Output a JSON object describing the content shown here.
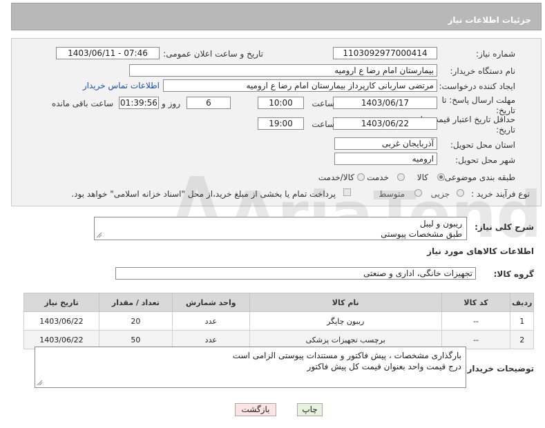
{
  "header": {
    "title": "جزئیات اطلاعات نیاز"
  },
  "form": {
    "need_number": {
      "label": "شماره نیاز:",
      "value": "1103092977000414"
    },
    "announce_datetime": {
      "label": "تاریخ و ساعت اعلان عمومی:",
      "value": "1403/06/11 - 07:46"
    },
    "buyer_org": {
      "label": "نام دستگاه خریدار:",
      "value": "بیمارستان امام رضا  ع  ارومیه"
    },
    "requester": {
      "label": "ایجاد کننده درخواست:",
      "value": "مرتضی ساربانی کارپرداز بیمارستان امام رضا  ع  ارومیه",
      "contact_link": "اطلاعات تماس خریدار"
    },
    "reply_deadline": {
      "label_line1": "مهلت ارسال پاسخ: تا",
      "label_line2": "تاریخ:",
      "date": "1403/06/17",
      "time_label": "ساعت",
      "time": "10:00",
      "days": "6",
      "days_label": "روز و",
      "remaining": "01:39:56",
      "remaining_label": "ساعت باقی مانده"
    },
    "price_validity": {
      "label_line1": "حداقل تاریخ اعتبار قیمت: تا",
      "label_line2": "تاریخ:",
      "date": "1403/06/22",
      "time_label": "ساعت",
      "time": "19:00"
    },
    "delivery_province": {
      "label": "استان محل تحویل:",
      "value": "آذربایجان غربی"
    },
    "delivery_city": {
      "label": "شهر محل تحویل:",
      "value": "ارومیه"
    },
    "category": {
      "label": "طبقه بندی موضوعی:",
      "options": [
        "کالا",
        "خدمت",
        "کالا/خدمت"
      ],
      "selected": "کالا"
    },
    "purchase_process": {
      "label": "نوع فرآیند خرید :",
      "options": [
        "جزیی",
        "متوسط"
      ],
      "payment_note": "پرداخت تمام یا بخشی از مبلغ خرید،از محل \"اسناد خزانه اسلامی\" خواهد بود."
    }
  },
  "summary": {
    "label": "شرح کلی نیاز:",
    "lines": [
      "ریبون و لیبل",
      "طبق مشخصات پیوستی"
    ]
  },
  "goods_section_title": "اطلاعات کالاهای مورد نیاز",
  "goods_group": {
    "label": "گروه کالا:",
    "value": "تجهیزات خانگی، اداری و صنعتی"
  },
  "table": {
    "headers": [
      "ردیف",
      "کد کالا",
      "نام کالا",
      "واحد شمارش",
      "تعداد / مقدار",
      "تاریخ نیاز"
    ],
    "rows": [
      [
        "1",
        "--",
        "ریبون چاپگر",
        "عدد",
        "20",
        "1403/06/22"
      ],
      [
        "2",
        "--",
        "برچسب تجهیزات پزشکی",
        "عدد",
        "50",
        "1403/06/22"
      ]
    ]
  },
  "buyer_notes": {
    "label": "توضیحات خریدار:",
    "lines": [
      "بارگذاری مشخصات ، پیش فاکتور و مستندات پیوستی الزامی است",
      "درج قیمت واحد بعنوان قیمت کل پیش فاکتور"
    ]
  },
  "buttons": {
    "print": "چاپ",
    "back": "بازگشت"
  },
  "watermark": {
    "text": "AriaTender.neT"
  },
  "colors": {
    "header_bg": "#b8b8b8",
    "link": "#1a4fa3",
    "back_button_bg": "#fde4e4",
    "print_button_bg": "#e7f2df"
  }
}
